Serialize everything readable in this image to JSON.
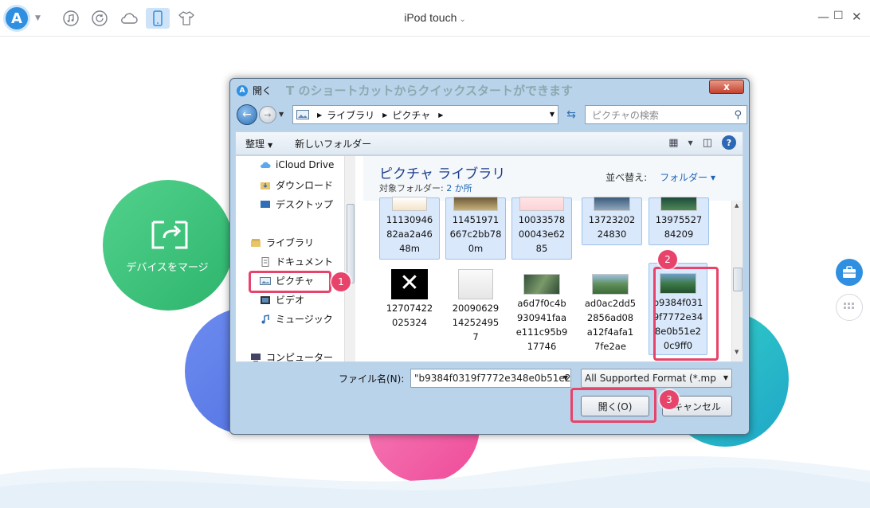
{
  "app": {
    "title": "iPod touch",
    "logo_text": "A",
    "toolbar_icons": [
      "music-icon",
      "restore-icon",
      "cloud-icon",
      "device-icon",
      "shirt-icon"
    ],
    "window_controls": [
      "minimize",
      "maximize",
      "close"
    ]
  },
  "background": {
    "feature_label": "デバイスをマージ",
    "colors": {
      "green": "#3dc27b",
      "blue": "#5a82e6",
      "pink": "#f06ab0",
      "teal": "#2bc1c8",
      "accent": "#2f8fe0"
    }
  },
  "dialog": {
    "title": "開く",
    "ghost_text": "T のショートカットからクイックスタートができます",
    "close_label": "x",
    "address": {
      "crumbs": [
        "ライブラリ",
        "ピクチャ"
      ]
    },
    "search_placeholder": "ピクチャの検索",
    "commands": {
      "organize": "整理",
      "new_folder": "新しいフォルダー"
    },
    "nav_items": [
      {
        "label": "iCloud Drive",
        "icon": "cloud-icon"
      },
      {
        "label": "ダウンロード",
        "icon": "download-folder-icon"
      },
      {
        "label": "デスクトップ",
        "icon": "desktop-icon"
      },
      {
        "label": "ライブラリ",
        "icon": "library-icon"
      },
      {
        "label": "ドキュメント",
        "icon": "document-icon"
      },
      {
        "label": "ピクチャ",
        "icon": "picture-icon"
      },
      {
        "label": "ビデオ",
        "icon": "video-icon"
      },
      {
        "label": "ミュージック",
        "icon": "music-icon"
      },
      {
        "label": "コンピューター",
        "icon": "computer-icon"
      }
    ],
    "library": {
      "title": "ピクチャ ライブラリ",
      "target_label": "対象フォルダー:",
      "target_value": "2 か所",
      "sort_label": "並べ替え:",
      "sort_value": "フォルダー"
    },
    "files_row1": [
      {
        "name": "1113094682aa2a4648m",
        "lines": [
          "11130946",
          "82aa2a46",
          "48m"
        ],
        "selected": true
      },
      {
        "name": "11451971667c2bb780m",
        "lines": [
          "11451971",
          "667c2bb78",
          "0m"
        ],
        "selected": true
      },
      {
        "name": "1003357800043e6285",
        "lines": [
          "10033578",
          "00043e62",
          "85"
        ],
        "selected": true
      },
      {
        "name": "1372320224830",
        "lines": [
          "13723202",
          "24830"
        ],
        "selected": true
      },
      {
        "name": "1397552784209",
        "lines": [
          "13975527",
          "84209"
        ],
        "selected": true
      }
    ],
    "files_row2": [
      {
        "name": "12707422025324",
        "lines": [
          "12707422",
          "025324"
        ],
        "selected": false
      },
      {
        "name": "20090629142524957",
        "lines": [
          "20090629",
          "14252495",
          "7"
        ],
        "selected": false
      },
      {
        "name": "a6d7f0c4b930941faae111c95b917746",
        "lines": [
          "a6d7f0c4b",
          "930941faa",
          "e111c95b9",
          "17746"
        ],
        "selected": false
      },
      {
        "name": "ad0ac2dd52856ad08a12f4afa17fe2ae",
        "lines": [
          "ad0ac2dd5",
          "2856ad08",
          "a12f4afa1",
          "7fe2ae"
        ],
        "selected": false
      },
      {
        "name": "b9384f0319f7772e348e0b51e20c9ff0",
        "lines": [
          "b9384f031",
          "9f7772e34",
          "8e0b51e2",
          "0c9ff0"
        ],
        "selected": true
      }
    ],
    "file_name_label": "ファイル名(N):",
    "file_name_value": "\"b9384f0319f7772e348e0b51e2",
    "format_value": "All Supported Format (*.mp",
    "open_label": "開く(O)",
    "cancel_label": "キャンセル"
  },
  "badges": [
    "1",
    "2",
    "3"
  ]
}
